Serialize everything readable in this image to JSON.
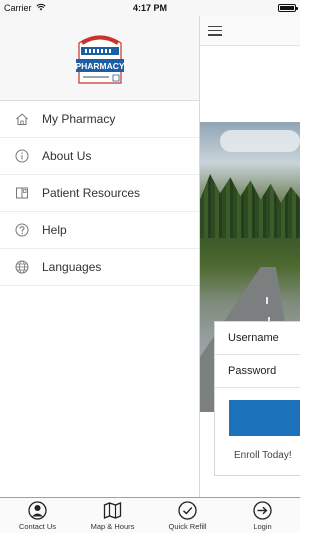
{
  "status_bar": {
    "carrier": "Carrier",
    "time": "4:17 PM"
  },
  "drawer": {
    "logo": {
      "arch_text": "HOMETOWN",
      "band_text": "HOMETOWN",
      "main_text": "PHARMACY",
      "sub_text": "PHARMACY INC"
    },
    "items": [
      {
        "label": "My Pharmacy",
        "icon": "home-icon"
      },
      {
        "label": "About Us",
        "icon": "info-icon"
      },
      {
        "label": "Patient Resources",
        "icon": "book-icon"
      },
      {
        "label": "Help",
        "icon": "question-icon"
      },
      {
        "label": "Languages",
        "icon": "globe-icon"
      }
    ]
  },
  "main": {
    "menu_icon": "hamburger-icon",
    "login": {
      "username_label": "Username",
      "password_label": "Password",
      "enroll_text": "Enroll Today!"
    },
    "accent_color": "#1b72bb"
  },
  "tab_bar": {
    "tabs": [
      {
        "label": "Contact Us",
        "icon": "person-icon"
      },
      {
        "label": "Map & Hours",
        "icon": "map-icon"
      },
      {
        "label": "Quick Refill",
        "icon": "checkmark-icon"
      },
      {
        "label": "Login",
        "icon": "login-icon"
      }
    ]
  }
}
